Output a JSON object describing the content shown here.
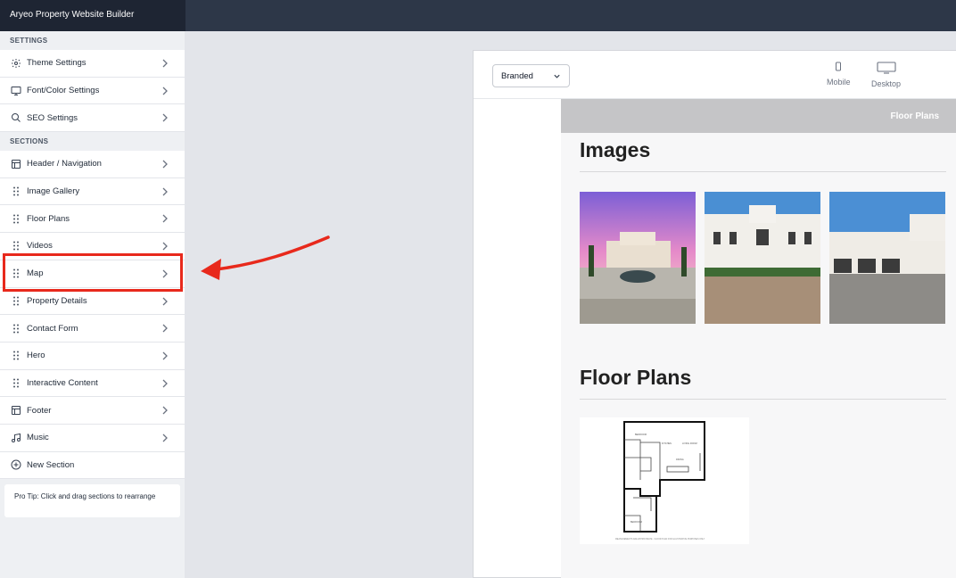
{
  "app": {
    "title": "Aryeo Property Website Builder"
  },
  "sidebar": {
    "settings_title": "SETTINGS",
    "settings": [
      {
        "label": "Theme Settings",
        "icon": "gear-icon"
      },
      {
        "label": "Font/Color Settings",
        "icon": "monitor-icon"
      },
      {
        "label": "SEO Settings",
        "icon": "search-icon"
      }
    ],
    "sections_title": "SECTIONS",
    "sections": [
      {
        "label": "Header / Navigation",
        "icon": "layout-icon"
      },
      {
        "label": "Image Gallery",
        "icon": "drag-handle-icon"
      },
      {
        "label": "Floor Plans",
        "icon": "drag-handle-icon"
      },
      {
        "label": "Videos",
        "icon": "drag-handle-icon"
      },
      {
        "label": "Map",
        "icon": "drag-handle-icon"
      },
      {
        "label": "Property Details",
        "icon": "drag-handle-icon"
      },
      {
        "label": "Contact Form",
        "icon": "drag-handle-icon"
      },
      {
        "label": "Hero",
        "icon": "drag-handle-icon"
      },
      {
        "label": "Interactive Content",
        "icon": "drag-handle-icon"
      },
      {
        "label": "Footer",
        "icon": "layout-icon"
      },
      {
        "label": "Music",
        "icon": "music-icon"
      },
      {
        "label": "New Section",
        "icon": "plus-circle-icon"
      }
    ],
    "tip": "Pro Tip: Click and drag sections to rearrange"
  },
  "preview": {
    "theme_select": "Branded",
    "devices": {
      "mobile": "Mobile",
      "desktop": "Desktop"
    },
    "nav_label": "Floor Plans",
    "images_heading": "Images",
    "floorplans_heading": "Floor Plans"
  },
  "colors": {
    "highlight": "#e8291c",
    "topbar": "#2d3748"
  }
}
